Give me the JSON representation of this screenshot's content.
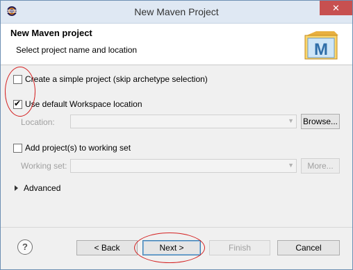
{
  "window": {
    "title": "New Maven Project",
    "close_glyph": "✕"
  },
  "banner": {
    "title": "New Maven project",
    "description": "Select project name and location",
    "logo_letter": "M"
  },
  "options": {
    "simple_project": {
      "label": "Create a simple project (skip archetype selection)",
      "checked": false
    },
    "default_workspace": {
      "label": "Use default Workspace location",
      "checked": true
    },
    "location": {
      "label": "Location:",
      "value": ""
    },
    "browse_label": "Browse...",
    "working_set_add": {
      "label": "Add project(s) to working set",
      "checked": false
    },
    "working_set": {
      "label": "Working set:",
      "value": ""
    },
    "more_label": "More...",
    "advanced_label": "Advanced"
  },
  "footer": {
    "help_glyph": "?",
    "back_label": "< Back",
    "next_label": "Next >",
    "finish_label": "Finish",
    "cancel_label": "Cancel"
  },
  "colors": {
    "annotation": "#d42020",
    "title_bar": "#dfe8f3",
    "close_button": "#c75050"
  }
}
